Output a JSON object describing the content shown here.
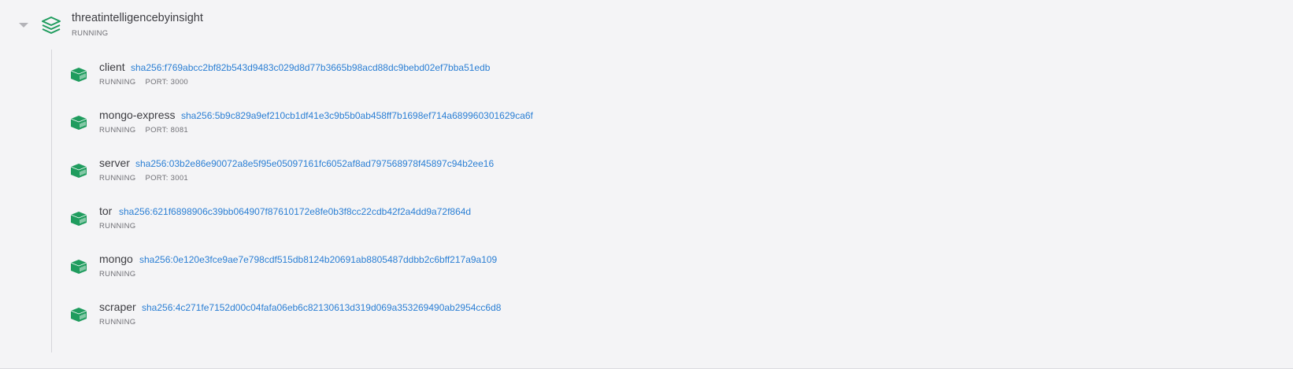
{
  "stack": {
    "name": "threatintelligencebyinsight",
    "status": "RUNNING",
    "icon": "layers-icon",
    "icon_color": "#1f9c5e"
  },
  "containers": [
    {
      "name": "client",
      "hash": "sha256:f769abcc2bf82b543d9483c029d8d77b3665b98acd88dc9bebd02ef7bba51edb",
      "status": "RUNNING",
      "port": "PORT: 3000"
    },
    {
      "name": "mongo-express",
      "hash": "sha256:5b9c829a9ef210cb1df41e3c9b5b0ab458ff7b1698ef714a689960301629ca6f",
      "status": "RUNNING",
      "port": "PORT: 8081"
    },
    {
      "name": "server",
      "hash": "sha256:03b2e86e90072a8e5f95e05097161fc6052af8ad797568978f45897c94b2ee16",
      "status": "RUNNING",
      "port": "PORT: 3001"
    },
    {
      "name": "tor",
      "hash": "sha256:621f6898906c39bb064907f87610172e8fe0b3f8cc22cdb42f2a4dd9a72f864d",
      "status": "RUNNING",
      "port": ""
    },
    {
      "name": "mongo",
      "hash": "sha256:0e120e3fce9ae7e798cdf515db8124b20691ab8805487ddbb2c6bff217a9a109",
      "status": "RUNNING",
      "port": ""
    },
    {
      "name": "scraper",
      "hash": "sha256:4c271fe7152d00c04fafa06eb6c82130613d319d069a353269490ab2954cc6d8",
      "status": "RUNNING",
      "port": ""
    }
  ],
  "colors": {
    "accent_green": "#1f9c5e",
    "link_blue": "#2b7fd4"
  }
}
